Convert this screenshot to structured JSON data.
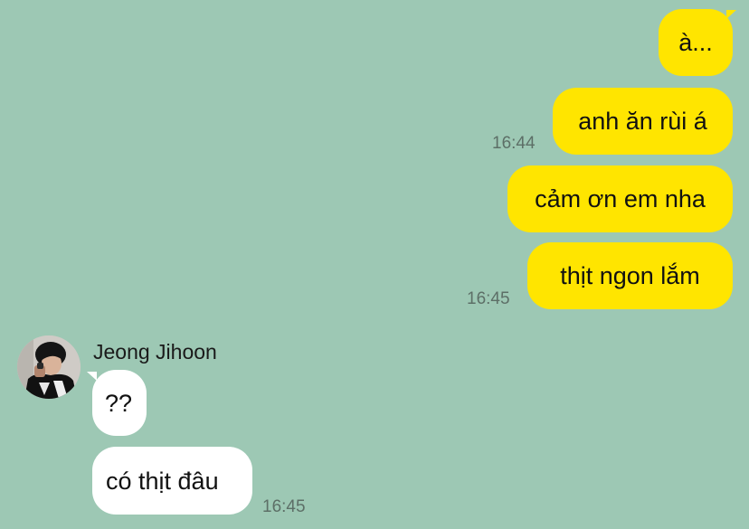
{
  "chat": {
    "messages_out": [
      {
        "text": "à..."
      },
      {
        "text": "anh ăn rùi á",
        "time": "16:44"
      },
      {
        "text": "cảm ơn em nha"
      },
      {
        "text": "thịt ngon lắm",
        "time": "16:45"
      }
    ],
    "contact": {
      "name": "Jeong Jihoon"
    },
    "messages_in": [
      {
        "text": "??"
      },
      {
        "text": "có thịt đâu",
        "time": "16:45"
      }
    ]
  },
  "colors": {
    "background": "#9dc8b4",
    "outgoing_bubble": "#ffe500",
    "incoming_bubble": "#ffffff",
    "timestamp": "#5d6f67"
  }
}
